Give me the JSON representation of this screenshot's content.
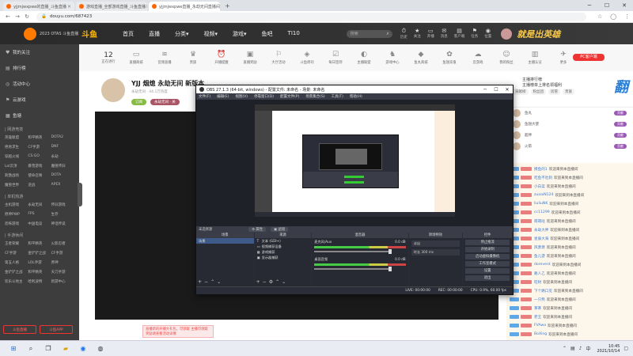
{
  "browser": {
    "tabs": [
      {
        "label": "yjjmjwxpwe的直播_斗鱼直播",
        "active": false
      },
      {
        "label": "游戏直播_全部游戏直播_斗鱼直播",
        "active": false
      },
      {
        "label": "yjjmjwxpwe直播_永劫无间直播间",
        "active": true
      }
    ],
    "url": "douyu.com/687423",
    "new_tab": "+",
    "window_minimize": "─",
    "window_maximize": "☐",
    "window_close": "✕"
  },
  "site": {
    "logo_text": "2023 OTAS 斗鱼直播",
    "brand": "斗鱼",
    "nav": [
      "首页",
      "直播",
      "分类▾",
      "视频▾",
      "游戏▾",
      "鱼吧",
      "TI10"
    ],
    "search_placeholder": "搜索",
    "header_icons": [
      {
        "glyph": "⏱",
        "label": "历史"
      },
      {
        "glyph": "★",
        "label": "关注"
      },
      {
        "glyph": "▭",
        "label": "开播"
      },
      {
        "glyph": "✉",
        "label": "消息"
      },
      {
        "glyph": "▤",
        "label": "客户端"
      },
      {
        "glyph": "⚑",
        "label": "任务"
      },
      {
        "glyph": "◉",
        "label": "位置"
      }
    ],
    "header_banner": "就是出英雄"
  },
  "sidebar": {
    "items": [
      {
        "icon": "♥",
        "label": "我的关注"
      },
      {
        "icon": "▤",
        "label": "排行榜"
      },
      {
        "icon": "◎",
        "label": "活动中心"
      },
      {
        "icon": "⚑",
        "label": "云游戏"
      },
      {
        "icon": "▦",
        "label": "鱼塘"
      }
    ],
    "sections": [
      {
        "title": "| 网游竞技",
        "games": [
          "英雄联盟",
          "和平精英",
          "DOTA2",
          "绝地求生",
          "CF手游",
          "DNF",
          "穿越火线",
          "CS:GO",
          "永劫",
          "Lol云顶",
          "暴雪游戏",
          "魔兽怀旧",
          "刺激战场",
          "使命召唤",
          "DOTA",
          "魔兽世界",
          "逆战",
          "APEX"
        ]
      },
      {
        "title": "| 单机热游",
        "games": [
          "主机游戏",
          "永劫无间",
          "怀旧游戏",
          "原神PWP",
          "FPS",
          "生存",
          "恐怖游戏",
          "中国电竞",
          "神话传说"
        ]
      },
      {
        "title": "| 手游休闲",
        "games": [
          "王者荣耀",
          "和平精英",
          "火影忍者",
          "CF手游",
          "金铲铲之战",
          "CF手游",
          "第五人格",
          "LOL手游",
          "原神",
          "金铲铲之战",
          "和平精英",
          "天刀手游",
          "欢乐斗地主",
          "哈利波特",
          "新游中心"
        ]
      }
    ],
    "btn_live": "斗鱼直播",
    "btn_app": "斗鱼APP"
  },
  "categories": {
    "count_value": "12",
    "count_label": "正在进行",
    "items": [
      {
        "glyph": "▭",
        "label": "直播商城"
      },
      {
        "glyph": "≋",
        "label": "音频直播"
      },
      {
        "glyph": "♛",
        "label": "贵族"
      },
      {
        "glyph": "⏰",
        "label": "开播提醒"
      },
      {
        "glyph": "▣",
        "label": "直播奖励"
      },
      {
        "glyph": "⚐",
        "label": "大厅活动"
      },
      {
        "glyph": "◈",
        "label": "斗鱼周刊"
      },
      {
        "glyph": "☑",
        "label": "每日签到"
      },
      {
        "glyph": "◐",
        "label": "主播联盟"
      },
      {
        "glyph": "♞",
        "label": "游戏中心"
      },
      {
        "glyph": "◆",
        "label": "鱼丸商城"
      },
      {
        "glyph": "✿",
        "label": "鱼翅充值"
      },
      {
        "glyph": "☁",
        "label": "云游戏"
      },
      {
        "glyph": "☺",
        "label": "我的粉丝"
      },
      {
        "glyph": "▥",
        "label": "主播认证"
      },
      {
        "glyph": "✈",
        "label": "更多"
      }
    ],
    "pc_badge": "PC客户端"
  },
  "stream": {
    "title": "YJJ 烟熄 永劫无间 新版本",
    "meta": "永劫无间 · 44.1万热度",
    "btn_follow": "订阅",
    "btn_report": "永劫无间 · 关"
  },
  "tip": {
    "text": "直播新的开播大礼包，可领取 主播可领取奖励请查看活动详情"
  },
  "right_panel": {
    "top_line": "主播排行榜",
    "sub_line": "主播榜单上排名领福利",
    "tabs": [
      "贡献榜",
      "粉丝团",
      "房管",
      "贵族"
    ],
    "big_text": "翻",
    "gifts": [
      {
        "name": "鱼丸",
        "tag": "贡献"
      },
      {
        "name": "鱼翅大使",
        "tag": "贡献"
      },
      {
        "name": "超神",
        "tag": "贡献"
      },
      {
        "name": "火箭",
        "tag": "贡献"
      }
    ],
    "chat": [
      {
        "name": "摸鱼的1",
        "text": "欢迎来到本直播间"
      },
      {
        "name": "吃鱼不吐刺",
        "text": "欢迎来到本直播间"
      },
      {
        "name": "小白菜",
        "text": "欢迎来到本直播间"
      },
      {
        "name": "zuoaiN124",
        "text": "欢迎来到本直播间"
      },
      {
        "name": "liuliuNK",
        "text": "欢迎来到本直播间"
      },
      {
        "name": "cc11299",
        "text": "欢迎来到本直播间"
      },
      {
        "name": "萌萌哒",
        "text": "欢迎来到本直播间"
      },
      {
        "name": "永劫大神",
        "text": "欢迎来到本直播间"
      },
      {
        "name": "星辰大海",
        "text": "欢迎来到本直播间"
      },
      {
        "name": "风萧萧",
        "text": "欢迎来到本直播间"
      },
      {
        "name": "鱼儿游",
        "text": "欢迎来到本直播间"
      },
      {
        "name": "dorevent",
        "text": "欢迎来到本直播间"
      },
      {
        "name": "路人乙",
        "text": "欢迎来到本直播间"
      },
      {
        "name": "旺财",
        "text": "欢迎来到本直播间"
      },
      {
        "name": "下个路口见",
        "text": "欢迎来到本直播间"
      },
      {
        "name": "一只熊",
        "text": "欢迎来到本直播间"
      },
      {
        "name": "茶茶",
        "text": "欢迎来到本直播间"
      },
      {
        "name": "老王",
        "text": "欢迎来到本直播间"
      },
      {
        "name": "FVAwa",
        "text": "欢迎来到本直播间"
      },
      {
        "name": "BoXing",
        "text": "欢迎来到本直播间"
      },
      {
        "name": "大头",
        "text": "欢迎来到本直播间"
      },
      {
        "name": "二狗子",
        "text": "欢迎来到本直播间"
      }
    ]
  },
  "obs": {
    "title": "OBS 27.1.3 (64-bit, windows) - 配置文件: 未命名 - 场景: 未命名",
    "menu": [
      "文件(F)",
      "编辑(E)",
      "视图(V)",
      "停靠窗口(D)",
      "配置文件(P)",
      "场景集合(S)",
      "工具(T)",
      "帮助(H)"
    ],
    "scene_label": "未选择源",
    "scene_btn1": "⚙ 属性",
    "scene_btn2": "▣ 滤镜",
    "docks": {
      "scenes_title": "场景",
      "scenes": [
        "场景"
      ],
      "sources_title": "来源",
      "sources": [
        {
          "icon": "T",
          "label": "文本 (GDI+)"
        },
        {
          "icon": "▭",
          "label": "视频捕获设备"
        },
        {
          "icon": "▦",
          "label": "游戏捕获"
        },
        {
          "icon": "▣",
          "label": "显示器捕获"
        }
      ],
      "mixer_title": "混音器",
      "mixer": [
        {
          "name": "麦克风/Aux",
          "db": "0.0 dB"
        },
        {
          "name": "桌面音频",
          "db": "0.0 dB"
        }
      ],
      "transitions_title": "转场特效",
      "transition_type": "淡出",
      "duration_label": "时长",
      "duration_value": "300 ms",
      "controls_title": "控件",
      "controls": [
        "停止推流",
        "开始录制",
        "启动虚拟摄像机",
        "工作室模式",
        "设置",
        "退出"
      ]
    },
    "status": [
      "LIVE: 00:00:00",
      "REC: 00:00:00",
      "CPU: 0.9%, 60.00 fps"
    ]
  },
  "taskbar": {
    "time": "10:45",
    "date": "2021/10/14",
    "lang": "中"
  }
}
